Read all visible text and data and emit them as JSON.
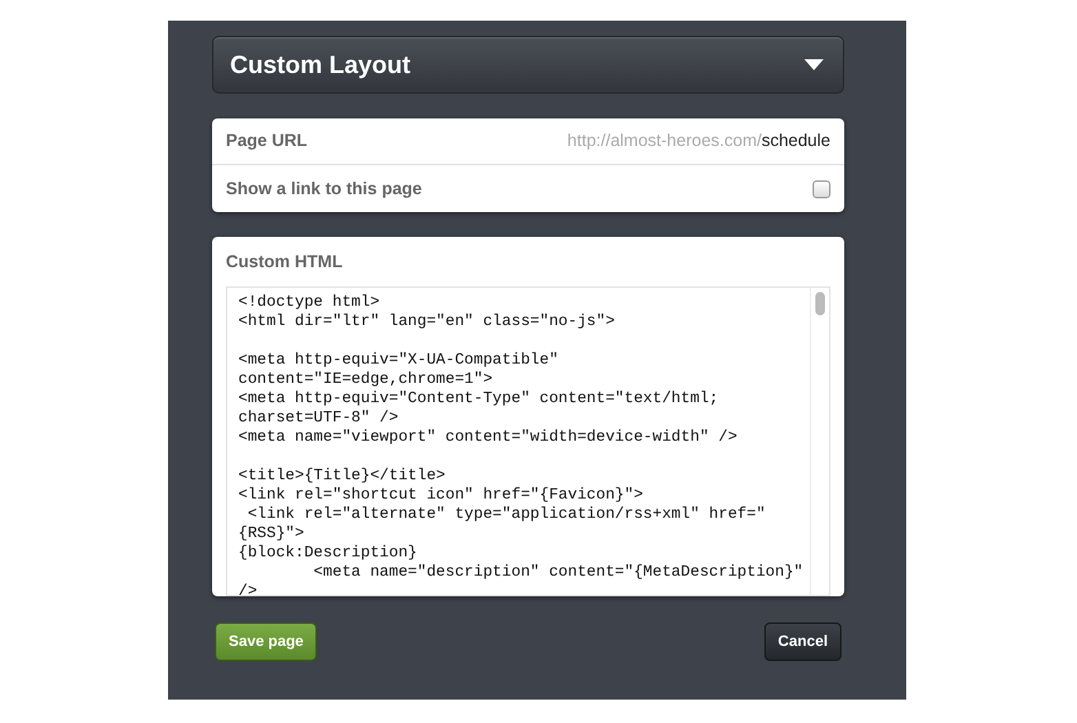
{
  "layout_select": {
    "value": "Custom Layout",
    "expanded": false
  },
  "page_url": {
    "label": "Page URL",
    "base": "http://almost-heroes.com/",
    "slug": "schedule"
  },
  "show_link": {
    "label": "Show a link to this page",
    "checked": false
  },
  "custom_html": {
    "label": "Custom HTML",
    "code": "<!doctype html>\n<html dir=\"ltr\" lang=\"en\" class=\"no-js\">\n\n<meta http-equiv=\"X-UA-Compatible\"\ncontent=\"IE=edge,chrome=1\">\n<meta http-equiv=\"Content-Type\" content=\"text/html;\ncharset=UTF-8\" />\n<meta name=\"viewport\" content=\"width=device-width\" />\n\n<title>{Title}</title>\n<link rel=\"shortcut icon\" href=\"{Favicon}\">\n <link rel=\"alternate\" type=\"application/rss+xml\" href=\"\n{RSS}\">\n{block:Description}\n        <meta name=\"description\" content=\"{MetaDescription}\"\n/>"
  },
  "buttons": [
    {
      "label": "Save page",
      "kind": "primary"
    },
    {
      "label": "Cancel",
      "kind": "secondary"
    }
  ]
}
